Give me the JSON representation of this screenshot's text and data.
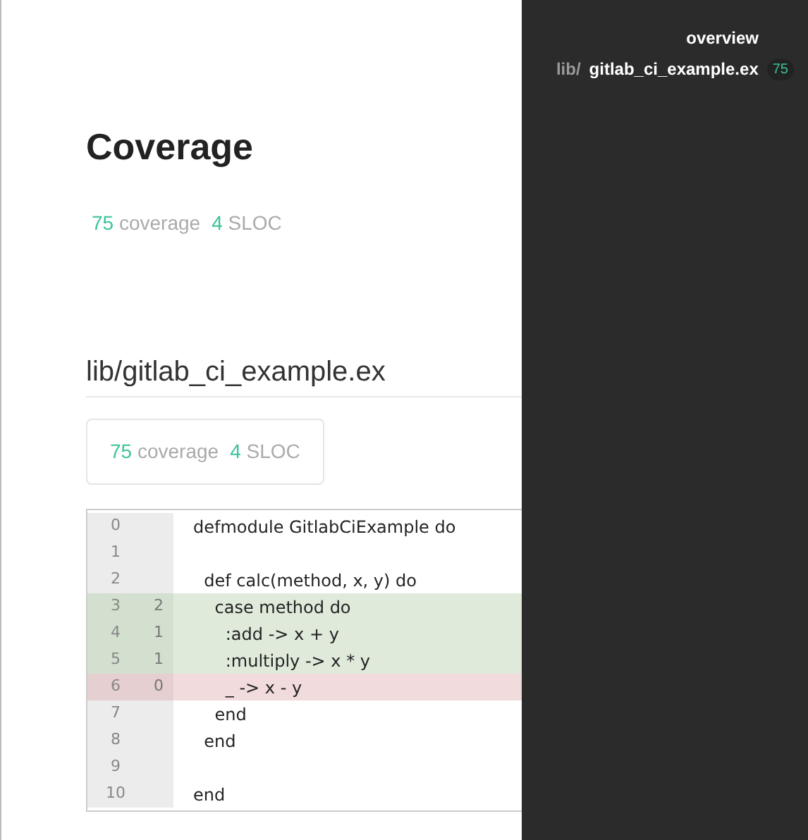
{
  "title": "Coverage",
  "summary": {
    "coverage": "75",
    "coverage_label": "coverage",
    "sloc": "4",
    "sloc_label": "SLOC"
  },
  "file": {
    "name": "lib/gitlab_ci_example.ex",
    "summary": {
      "coverage": "75",
      "coverage_label": "coverage",
      "sloc": "4",
      "sloc_label": "SLOC"
    },
    "lines": [
      {
        "number": "0",
        "code": "defmodule GitlabCiExample do",
        "kind": "none"
      },
      {
        "number": "1",
        "kind": "none"
      },
      {
        "number": "2",
        "code": "  def calc(method, x, y) do",
        "kind": "none"
      },
      {
        "number": "3",
        "hits": "2",
        "code": "    case method do",
        "kind": "hit"
      },
      {
        "number": "4",
        "hits": "1",
        "code": "      :add -> x + y",
        "kind": "hit"
      },
      {
        "number": "5",
        "hits": "1",
        "code": "      :multiply -> x * y",
        "kind": "hit"
      },
      {
        "number": "6",
        "hits": "0",
        "code": "      _ -> x - y",
        "kind": "miss"
      },
      {
        "number": "7",
        "code": "    end",
        "kind": "none"
      },
      {
        "number": "8",
        "code": "  end",
        "kind": "none"
      },
      {
        "number": "9",
        "kind": "none"
      },
      {
        "number": "10",
        "code": "end",
        "kind": "none"
      }
    ]
  },
  "sidebar": {
    "overview": "overview",
    "files": [
      {
        "dir": "lib/",
        "name": "gitlab_ci_example.ex",
        "coverage": "75"
      }
    ]
  }
}
